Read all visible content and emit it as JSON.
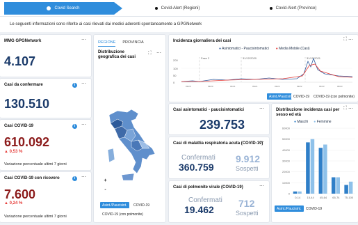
{
  "steps": [
    {
      "label": "Covid Search",
      "active": true
    },
    {
      "label": "Covid-Alert (Regioni)"
    },
    {
      "label": "Covid-Alert (Province)"
    }
  ],
  "info_text": "Le seguenti informazioni sono riferite ai casi rilevati dai medici aderenti spontaneamente a GPGNetwork",
  "kpi": {
    "mmg": {
      "title": "MMG GPGNetwork",
      "value": "4.107"
    },
    "confirm": {
      "title": "Casi da confermare",
      "value": "130.510"
    },
    "covid": {
      "title": "Casi COVID-19",
      "value": "610.092",
      "delta": "0,53 %",
      "note": "Variazione percentuale ultimi 7 giorni"
    },
    "ricovero": {
      "title": "Casi COVID-19 con ricovero",
      "value": "7.600",
      "delta": "0,24 %",
      "note": "Variazione percentuale ultimi 7 giorni"
    }
  },
  "map": {
    "tabs": [
      "REGIONE",
      "PROVINCIA"
    ],
    "title": "Distribuzione geografica dei casi",
    "zoom_in": "+",
    "zoom_out": "-",
    "buttons": [
      "Asint./Paucisint.",
      "COVID-19",
      "COVID-19 (con polmonite)"
    ]
  },
  "incidence": {
    "title": "Incidenza giornaliera dei casi",
    "legend": [
      "Asintomatici - Paucisintomatici",
      "Media Mobile (Casi)"
    ],
    "y_ticks": [
      "200",
      "100",
      "50",
      "0"
    ],
    "markers": [
      "Fase 2",
      "31/12/2020",
      "31/12/2021"
    ],
    "buttons": [
      "Asint./Paucisint.",
      "COVID-19",
      "COVID-19 (con polmonite)"
    ]
  },
  "asint": {
    "title": "Casi asintomatici - paucisintomatici",
    "value": "239.753"
  },
  "acuta": {
    "title": "Casi di malattia respiratoria acuta (COVID-19)",
    "confirmed": "360.759",
    "confirmed_label": "Confermati",
    "suspected": "9.912",
    "suspected_label": "Sospetti"
  },
  "polm": {
    "title": "Casi di polmonite virale (COVID-19)",
    "confirmed": "19.462",
    "confirmed_label": "Confermati",
    "suspected": "712",
    "suspected_label": "Sospetti"
  },
  "sexage": {
    "title": "Distribuzione incidenza casi per sesso ed età",
    "legend": [
      "Maschi",
      "Femmine"
    ],
    "buttons": [
      "Asint./Paucisint.",
      "COVID-19"
    ],
    "y_ticks": [
      "60000",
      "50000",
      "40000",
      "30000",
      "20000",
      "10000",
      "0"
    ]
  },
  "chart_data": [
    {
      "type": "bar",
      "title": "Distribuzione incidenza casi per sesso ed età",
      "categories": [
        "0-14",
        "15-44",
        "45-64",
        "65-74",
        "75-100"
      ],
      "series": [
        {
          "name": "Maschi",
          "values": [
            2000,
            47000,
            42000,
            15000,
            8000
          ]
        },
        {
          "name": "Femmine",
          "values": [
            2000,
            50000,
            45000,
            15000,
            11000
          ]
        }
      ],
      "ylim": [
        0,
        60000
      ],
      "colors": [
        "#2f7fc8",
        "#8ec1ea"
      ]
    },
    {
      "type": "line",
      "title": "Incidenza giornaliera dei casi",
      "y_ticks": [
        0,
        50,
        100,
        200
      ],
      "series": [
        {
          "name": "Asintomatici - Paucisintomatici",
          "color": "#2f5b9e"
        },
        {
          "name": "Media Mobile (Casi)",
          "color": "#e53935"
        }
      ]
    }
  ]
}
